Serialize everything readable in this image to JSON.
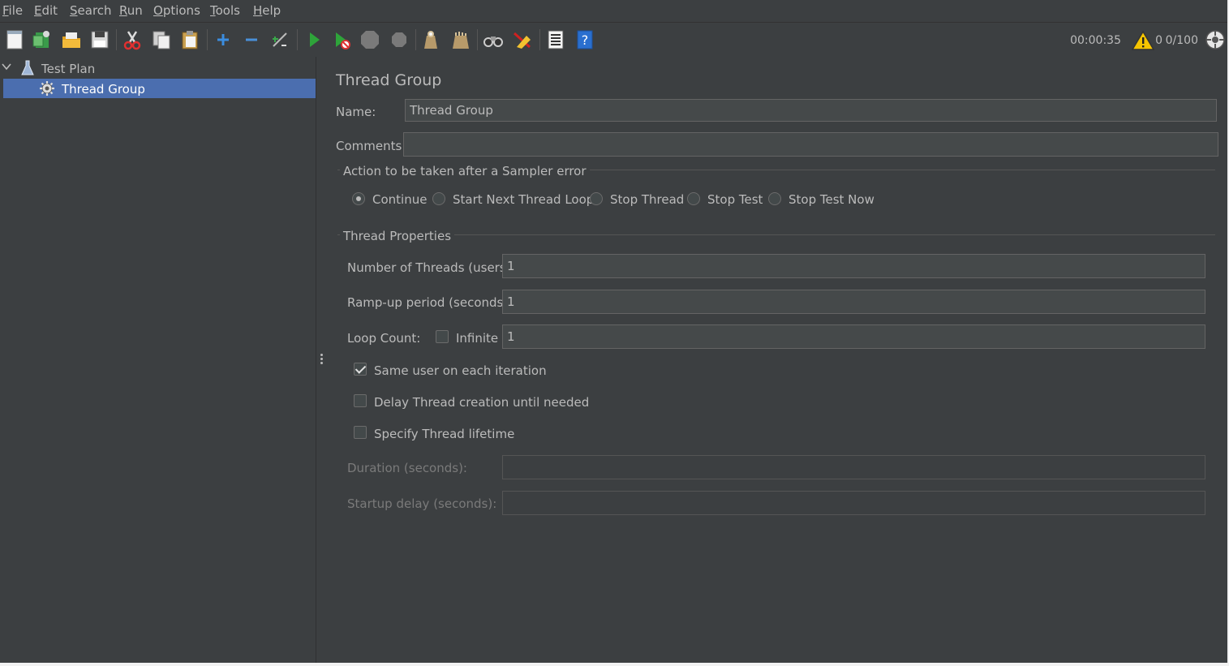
{
  "menu": [
    "File",
    "Edit",
    "Search",
    "Run",
    "Options",
    "Tools",
    "Help"
  ],
  "toolbar_icons": [
    "new-icon",
    "templates-icon",
    "open-icon",
    "save-icon",
    "cut-icon",
    "copy-icon",
    "paste-icon",
    "expand-icon",
    "collapse-icon",
    "toggle-icon",
    "start-icon",
    "start-no-timers-icon",
    "stop-icon",
    "shutdown-icon",
    "clear-icon",
    "clear-all-icon",
    "search-icon",
    "reset-search-icon",
    "function-helper-icon",
    "help-icon"
  ],
  "status": {
    "elapsed": "00:00:35",
    "errors": "0",
    "threads": "0/100"
  },
  "tree": {
    "root": "Test Plan",
    "child": "Thread Group"
  },
  "panel": {
    "title": "Thread Group",
    "name_label": "Name:",
    "name_value": "Thread Group",
    "comments_label": "Comments:",
    "comments_value": "",
    "error_group_title": "Action to be taken after a Sampler error",
    "error_actions": [
      "Continue",
      "Start Next Thread Loop",
      "Stop Thread",
      "Stop Test",
      "Stop Test Now"
    ],
    "selected_error_action": "Continue",
    "props_title": "Thread Properties",
    "threads_label": "Number of Threads (users):",
    "threads_value": "1",
    "rampup_label": "Ramp-up period (seconds):",
    "rampup_value": "1",
    "loop_label": "Loop Count:",
    "infinite_label": "Infinite",
    "loop_value": "1",
    "same_user_label": "Same user on each iteration",
    "same_user_checked": true,
    "delay_label": "Delay Thread creation until needed",
    "delay_checked": false,
    "lifetime_label": "Specify Thread lifetime",
    "lifetime_checked": false,
    "duration_label": "Duration (seconds):",
    "duration_value": "",
    "startup_label": "Startup delay (seconds):",
    "startup_value": ""
  },
  "colors": {
    "background": "#3c3f41",
    "selection": "#4b6eaf",
    "field": "#45494a",
    "text": "#bbbbbb"
  }
}
